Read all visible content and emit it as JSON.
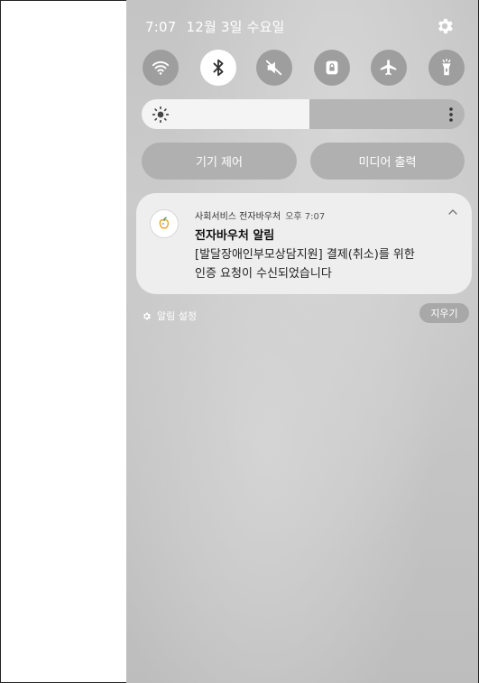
{
  "status_bar": {
    "time": "7:07",
    "date": "12월 3일 수요일"
  },
  "quick_settings": [
    {
      "name": "wifi-icon",
      "active": false
    },
    {
      "name": "bluetooth-icon",
      "active": true
    },
    {
      "name": "sound-mute-icon",
      "active": false
    },
    {
      "name": "lock-rotation-icon",
      "active": false
    },
    {
      "name": "airplane-icon",
      "active": false
    },
    {
      "name": "flashlight-icon",
      "active": false
    }
  ],
  "brightness": {
    "level": 0.52
  },
  "buttons": {
    "device_control": "기기 제어",
    "media_output": "미디어 출력"
  },
  "notification": {
    "app_name": "사회서비스 전자바우처",
    "time": "오후 7:07",
    "title": "전자바우처 알림",
    "body_line1": "[발달장애인부모상담지원] 결제(취소)를 위한",
    "body_line2": "인증 요청이 수신되었습니다"
  },
  "footer": {
    "notification_settings": "알림 설정",
    "clear": "지우기"
  },
  "colors": {
    "shade": "#c6c6c6",
    "tile_off": "#9e9e9e",
    "tile_on": "#ffffff",
    "card": "#eeeeee"
  }
}
